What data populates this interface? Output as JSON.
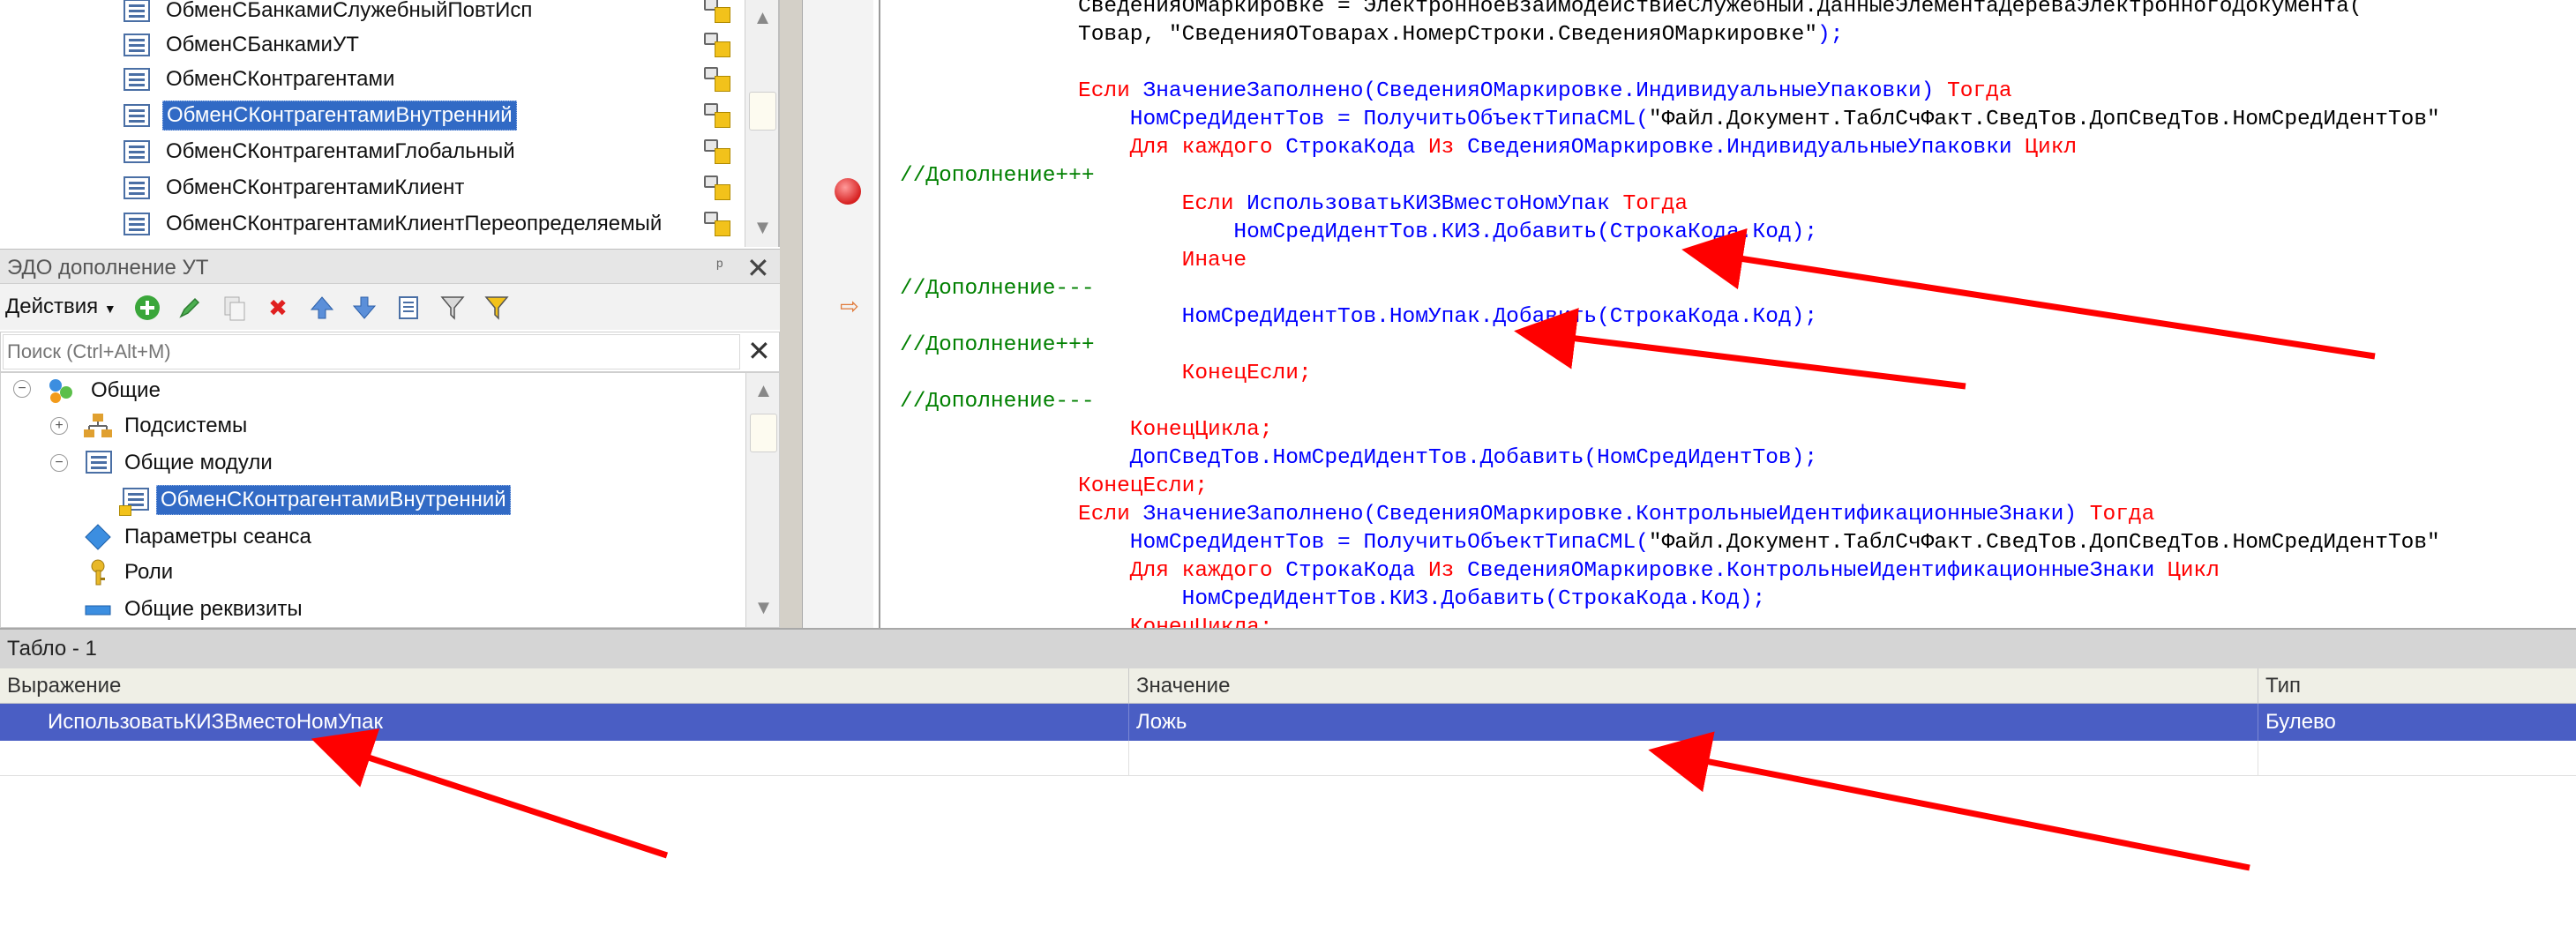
{
  "top_tree": {
    "items": [
      {
        "label": "ОбменСБанкамиСлужебныйПовтИсп",
        "selected": false
      },
      {
        "label": "ОбменСБанкамиУТ",
        "selected": false
      },
      {
        "label": "ОбменСКонтрагентами",
        "selected": false
      },
      {
        "label": "ОбменСКонтрагентамиВнутренний",
        "selected": true
      },
      {
        "label": "ОбменСКонтрагентамиГлобальный",
        "selected": false
      },
      {
        "label": "ОбменСКонтрагентамиКлиент",
        "selected": false
      },
      {
        "label": "ОбменСКонтрагентамиКлиентПереопределяемый",
        "selected": false
      }
    ]
  },
  "edo_panel": {
    "title": "ЭДО дополнение УТ",
    "actions_label": "Действия",
    "search_placeholder": "Поиск (Ctrl+Alt+M)",
    "tree": {
      "common": "Общие",
      "subsystems": "Подсистемы",
      "common_modules": "Общие модули",
      "module": "ОбменСКонтрагентамиВнутренний",
      "session_params": "Параметры сеанса",
      "roles": "Роли",
      "common_attrs": "Общие реквизиты"
    }
  },
  "code_lines": [
    [
      {
        "c": "t",
        "s": "СведенияОМаркировке = ЭлектронноеВзаимодействиеСлужебный.ДанныеЭлементаДереваЭлектронногоДокумента("
      }
    ],
    [
      {
        "c": "t",
        "s": "Товар, \"СведенияОТоварах.НомерСтроки.СведенияОМаркировке\""
      },
      {
        "c": "b",
        "s": ");"
      }
    ],
    [],
    [
      {
        "c": "k",
        "s": "Если "
      },
      {
        "c": "b",
        "s": "ЗначениеЗаполнено(СведенияОМаркировке.ИндивидуальныеУпаковки) "
      },
      {
        "c": "k",
        "s": "Тогда"
      }
    ],
    [
      {
        "c": "b",
        "s": "    НомСредИдентТов = ПолучитьОбъектТипаCML("
      },
      {
        "c": "t",
        "s": "\"Файл.Документ.ТаблСчФакт.СведТов.ДопСведТов.НомСредИдентТов\""
      }
    ],
    [
      {
        "c": "k",
        "s": "    Для каждого "
      },
      {
        "c": "b",
        "s": "СтрокаКода "
      },
      {
        "c": "k",
        "s": "Из "
      },
      {
        "c": "b",
        "s": "СведенияОМаркировке.ИндивидуальныеУпаковки "
      },
      {
        "c": "k",
        "s": "Цикл"
      }
    ],
    [
      {
        "c": "g",
        "s": "//Дополнение+++"
      }
    ],
    [
      {
        "c": "k",
        "s": "        Если "
      },
      {
        "c": "b",
        "s": "ИспользоватьКИЗВместоНомУпак "
      },
      {
        "c": "k",
        "s": "Тогда"
      }
    ],
    [
      {
        "c": "b",
        "s": "            НомСредИдентТов.КИЗ.Добавить(СтрокаКода.Код);"
      }
    ],
    [
      {
        "c": "k",
        "s": "        Иначе"
      }
    ],
    [
      {
        "c": "g",
        "s": "//Дополнение---"
      }
    ],
    [
      {
        "c": "b",
        "s": "        НомСредИдентТов.НомУпак.Добавить(СтрокаКода.Код);"
      }
    ],
    [
      {
        "c": "g",
        "s": "//Дополнение+++"
      }
    ],
    [
      {
        "c": "k",
        "s": "        КонецЕсли;"
      }
    ],
    [
      {
        "c": "g",
        "s": "//Дополнение---"
      }
    ],
    [
      {
        "c": "k",
        "s": "    КонецЦикла;"
      }
    ],
    [
      {
        "c": "b",
        "s": "    ДопСведТов.НомСредИдентТов.Добавить(НомСредИдентТов);"
      }
    ],
    [
      {
        "c": "k",
        "s": "КонецЕсли;"
      }
    ],
    [
      {
        "c": "k",
        "s": "Если "
      },
      {
        "c": "b",
        "s": "ЗначениеЗаполнено(СведенияОМаркировке.КонтрольныеИдентификационныеЗнаки) "
      },
      {
        "c": "k",
        "s": "Тогда"
      }
    ],
    [
      {
        "c": "b",
        "s": "    НомСредИдентТов = ПолучитьОбъектТипаCML("
      },
      {
        "c": "t",
        "s": "\"Файл.Документ.ТаблСчФакт.СведТов.ДопСведТов.НомСредИдентТов\""
      }
    ],
    [
      {
        "c": "k",
        "s": "    Для каждого "
      },
      {
        "c": "b",
        "s": "СтрокаКода "
      },
      {
        "c": "k",
        "s": "Из "
      },
      {
        "c": "b",
        "s": "СведенияОМаркировке.КонтрольныеИдентификационныеЗнаки "
      },
      {
        "c": "k",
        "s": "Цикл"
      }
    ],
    [
      {
        "c": "b",
        "s": "        НомСредИдентТов.КИЗ.Добавить(СтрокаКода.Код);"
      }
    ],
    [
      {
        "c": "k",
        "s": "    КонецЦикла;"
      }
    ]
  ],
  "watch": {
    "title": "Табло - 1",
    "columns": {
      "expr": "Выражение",
      "value": "Значение",
      "type": "Тип"
    },
    "row": {
      "expr": "ИспользоватьКИЗВместоНомУпак",
      "value": "Ложь",
      "type": "Булево"
    }
  },
  "colors": {
    "keyword": "#ff0000",
    "identifier": "#0000ff",
    "comment": "#008000",
    "selection": "#316ac5",
    "watch_row": "#4a5ec4",
    "arrow": "#ff0000"
  }
}
